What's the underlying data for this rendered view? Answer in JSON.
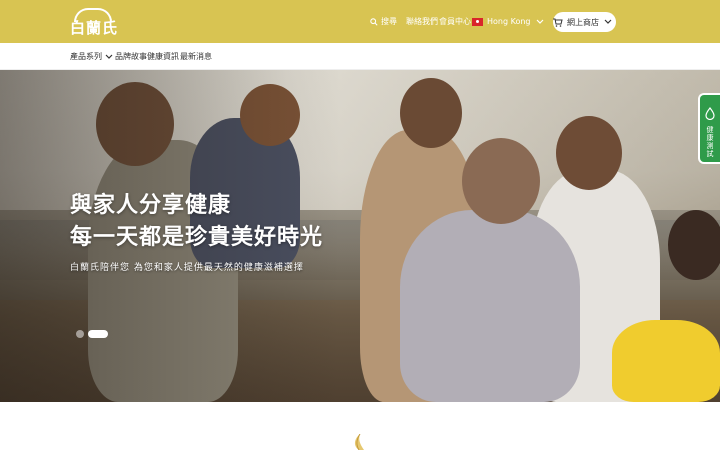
{
  "header": {
    "logo_text": "白蘭氏",
    "search_label": "搜尋",
    "links": [
      "聯絡我們",
      "會員中心"
    ],
    "region": "Hong Kong",
    "cart_label": "網上商店"
  },
  "nav": {
    "items": [
      "產品系列",
      "品牌故事",
      "健康資訊",
      "最新消息"
    ]
  },
  "hero": {
    "title_line1": "與家人分享健康",
    "title_line2": "每一天都是珍貴美好時光",
    "subtitle": "白蘭氏陪伴您 為您和家人提供最天然的健康滋補選擇",
    "slide_count": 2,
    "active_slide": 2
  },
  "side_tab": {
    "label": "健康測試"
  },
  "colors": {
    "brand": "#d8c452",
    "side_tab": "#2f9b4a"
  }
}
